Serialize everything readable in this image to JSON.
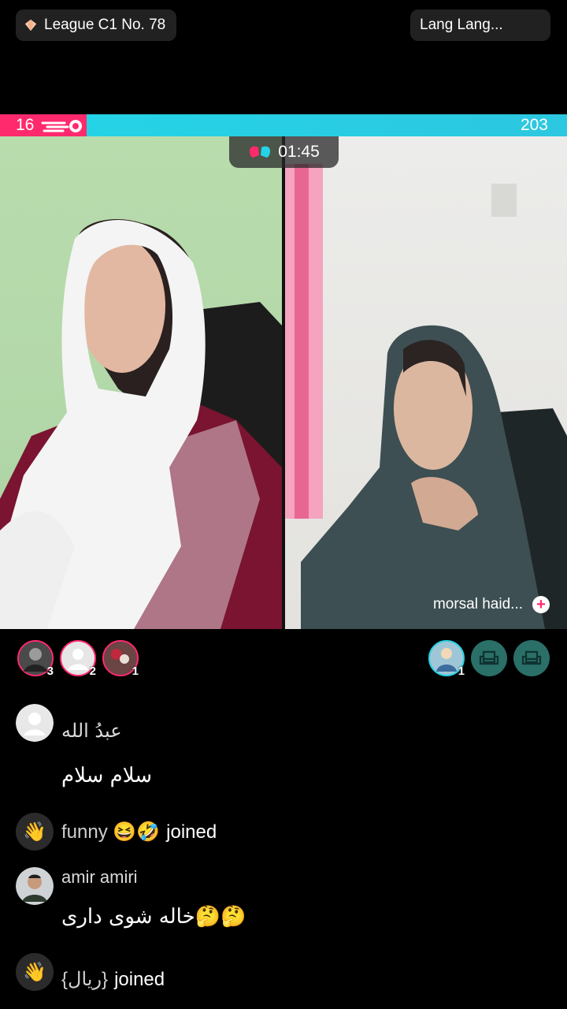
{
  "header": {
    "league_label": "League C1 No. 78",
    "host_label": "Lang Lang..."
  },
  "battle": {
    "left_score": "16",
    "right_score": "203",
    "timer": "01:45",
    "left_color": "#ff2a6d",
    "right_color": "#25d3e6",
    "opponent_name": "morsal haid..."
  },
  "supporters": {
    "left": [
      {
        "rank": "3"
      },
      {
        "rank": "2"
      },
      {
        "rank": "1"
      }
    ],
    "right": [
      {
        "rank": "1"
      }
    ]
  },
  "chat": [
    {
      "type": "comment",
      "username": "عبدُ الله",
      "text": "سلام سلام"
    },
    {
      "type": "join",
      "username": "funny 😆🤣",
      "action": "joined"
    },
    {
      "type": "comment",
      "username": "amir amiri",
      "text": "خاله شوی داری🤔🤔"
    },
    {
      "type": "join",
      "username": "{ریال}",
      "action": "joined"
    }
  ]
}
